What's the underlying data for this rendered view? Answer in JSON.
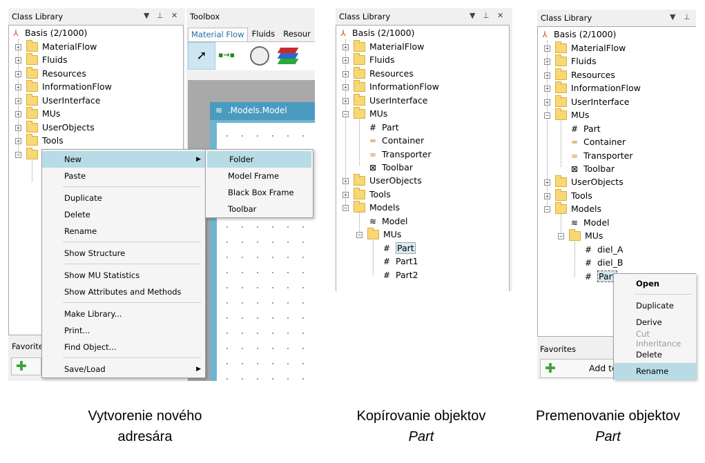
{
  "panel1": {
    "header": "Class Library",
    "tree": [
      {
        "label": "Basis (2/1000)"
      },
      {
        "label": "MaterialFlow"
      },
      {
        "label": "Fluids"
      },
      {
        "label": "Resources"
      },
      {
        "label": "InformationFlow"
      },
      {
        "label": "UserInterface"
      },
      {
        "label": "MUs"
      },
      {
        "label": "UserObjects"
      },
      {
        "label": "Tools"
      }
    ],
    "favorites_label": "Favorite",
    "context_menu": [
      "New",
      "Paste",
      "Duplicate",
      "Delete",
      "Rename",
      "Show Structure",
      "Show MU Statistics",
      "Show Attributes and Methods",
      "Make Library...",
      "Print...",
      "Find Object...",
      "Save/Load"
    ],
    "submenu": [
      "Folder",
      "Model Frame",
      "Black Box Frame",
      "Toolbar"
    ]
  },
  "toolbox": {
    "header": "Toolbox",
    "tabs": [
      "Material Flow",
      "Fluids",
      "Resour"
    ],
    "window_title": ".Models.Model"
  },
  "panel2": {
    "header": "Class Library",
    "tree": [
      {
        "label": "Basis (2/1000)"
      },
      {
        "label": "MaterialFlow"
      },
      {
        "label": "Fluids"
      },
      {
        "label": "Resources"
      },
      {
        "label": "InformationFlow"
      },
      {
        "label": "UserInterface"
      },
      {
        "label": "MUs"
      },
      {
        "label": "Part"
      },
      {
        "label": "Container"
      },
      {
        "label": "Transporter"
      },
      {
        "label": "Toolbar"
      },
      {
        "label": "UserObjects"
      },
      {
        "label": "Tools"
      },
      {
        "label": "Models"
      },
      {
        "label": "Model"
      },
      {
        "label": "MUs"
      },
      {
        "label": "Part"
      },
      {
        "label": "Part1"
      },
      {
        "label": "Part2"
      }
    ]
  },
  "panel3": {
    "header": "Class Library",
    "tree": [
      {
        "label": "Basis (2/1000)"
      },
      {
        "label": "MaterialFlow"
      },
      {
        "label": "Fluids"
      },
      {
        "label": "Resources"
      },
      {
        "label": "InformationFlow"
      },
      {
        "label": "UserInterface"
      },
      {
        "label": "MUs"
      },
      {
        "label": "Part"
      },
      {
        "label": "Container"
      },
      {
        "label": "Transporter"
      },
      {
        "label": "Toolbar"
      },
      {
        "label": "UserObjects"
      },
      {
        "label": "Tools"
      },
      {
        "label": "Models"
      },
      {
        "label": "Model"
      },
      {
        "label": "MUs"
      },
      {
        "label": "diel_A"
      },
      {
        "label": "diel_B"
      },
      {
        "label": "Part"
      }
    ],
    "favorites_label": "Favorites",
    "add_button": "Add to",
    "context_menu": [
      "Open",
      "Duplicate",
      "Derive",
      "Cut Inheritance",
      "Delete",
      "Rename"
    ]
  },
  "captions": {
    "c1_line1": "Vytvorenie nového",
    "c1_line2": "adresára",
    "c2_line1": "Kopírovanie objektov",
    "c2_line2": "Part",
    "c3_line1": "Premenovanie objektov",
    "c3_line2": "Part"
  },
  "colors": {
    "highlight": "#b8dce6",
    "folder": "#f8d775",
    "title_bar": "#4a9bbf",
    "canvas_frame": "#6fb4d0"
  },
  "icons": {
    "header_controls": [
      "dropdown-arrow-icon",
      "pin-icon",
      "close-icon"
    ],
    "root": "basis-icon",
    "part": "part-icon",
    "container": "container-icon",
    "transporter": "transporter-icon",
    "toolbar": "toolbar-icon",
    "model": "model-frame-icon",
    "favorites_add": "plus-icon",
    "toolbox": [
      "pointer-icon",
      "connector-icon",
      "stopwatch-icon",
      "layers-icon"
    ]
  }
}
